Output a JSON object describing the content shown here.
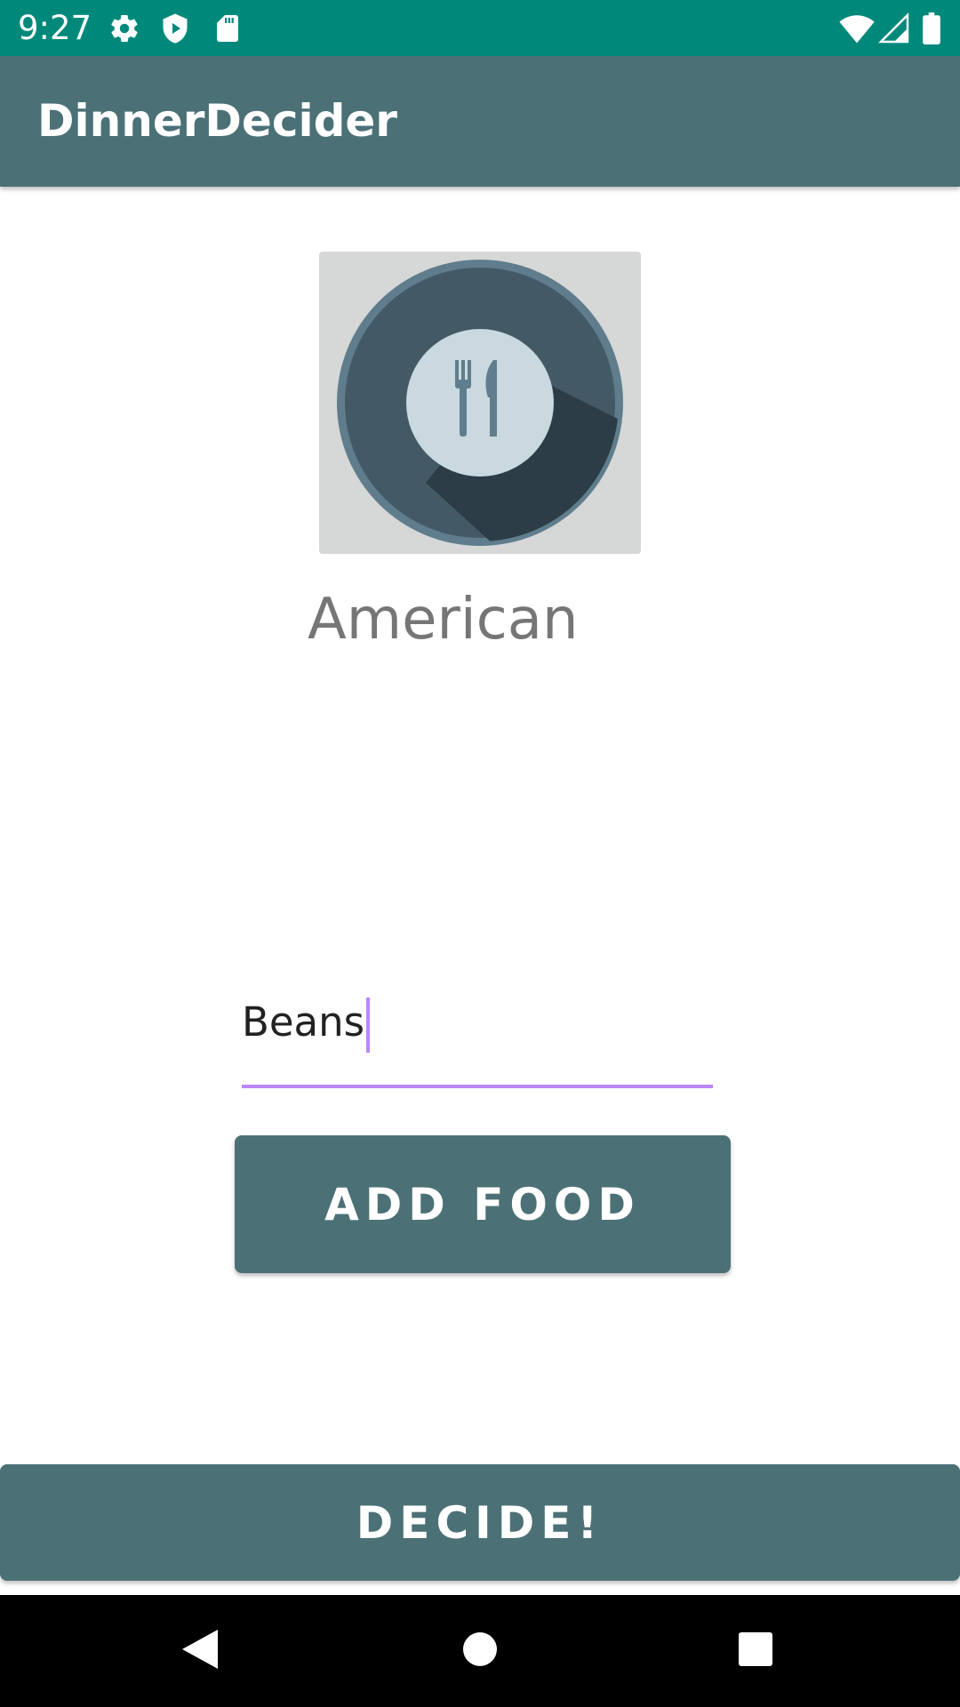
{
  "status_bar": {
    "time": "9:27",
    "icons_left": [
      "settings-gear-icon",
      "shield-play-icon",
      "sd-card-icon"
    ],
    "icons_right": [
      "wifi-icon",
      "cell-signal-icon",
      "battery-icon"
    ]
  },
  "app_bar": {
    "title": "DinnerDecider"
  },
  "main": {
    "image_icon": "plate-fork-knife-icon",
    "cuisine": "American",
    "food_input_value": "Beans",
    "add_button_label": "ADD FOOD",
    "decide_button_label": "DECIDE!"
  },
  "nav_bar": {
    "buttons": [
      "back-icon",
      "home-icon",
      "recents-icon"
    ]
  },
  "colors": {
    "status_bar": "#00897b",
    "primary": "#4b7177",
    "accent_underline": "#bb86fc",
    "cuisine_text": "#767676"
  }
}
